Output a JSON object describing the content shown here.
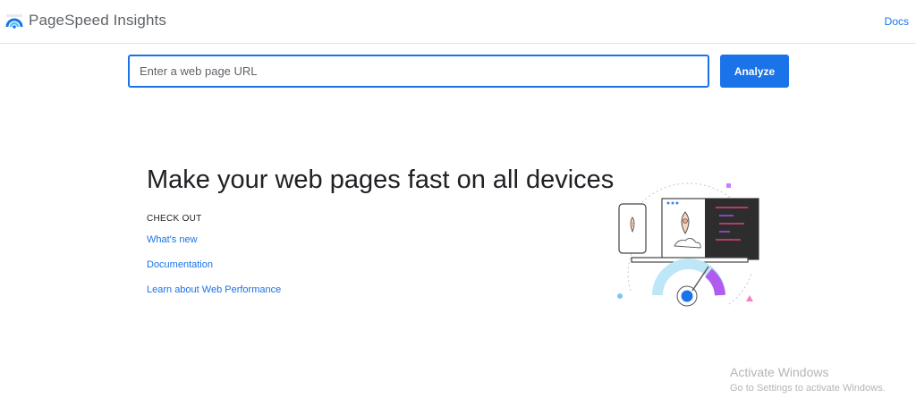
{
  "header": {
    "logo_icon": "pagespeed-gauge-icon",
    "title": "PageSpeed Insights",
    "docs_link": "Docs"
  },
  "search": {
    "placeholder": "Enter a web page URL",
    "value": "",
    "button_label": "Analyze"
  },
  "hero": {
    "title": "Make your web pages fast on all devices",
    "check_out_label": "CHECK OUT",
    "links": [
      "What's new",
      "Documentation",
      "Learn about Web Performance"
    ],
    "illustration_icon": "rocket-speed-gauge-illustration"
  },
  "watermark": {
    "title": "Activate Windows",
    "subtitle": "Go to Settings to activate Windows."
  },
  "colors": {
    "accent": "#1a73e8",
    "text": "#202124",
    "muted": "#5f6368"
  }
}
